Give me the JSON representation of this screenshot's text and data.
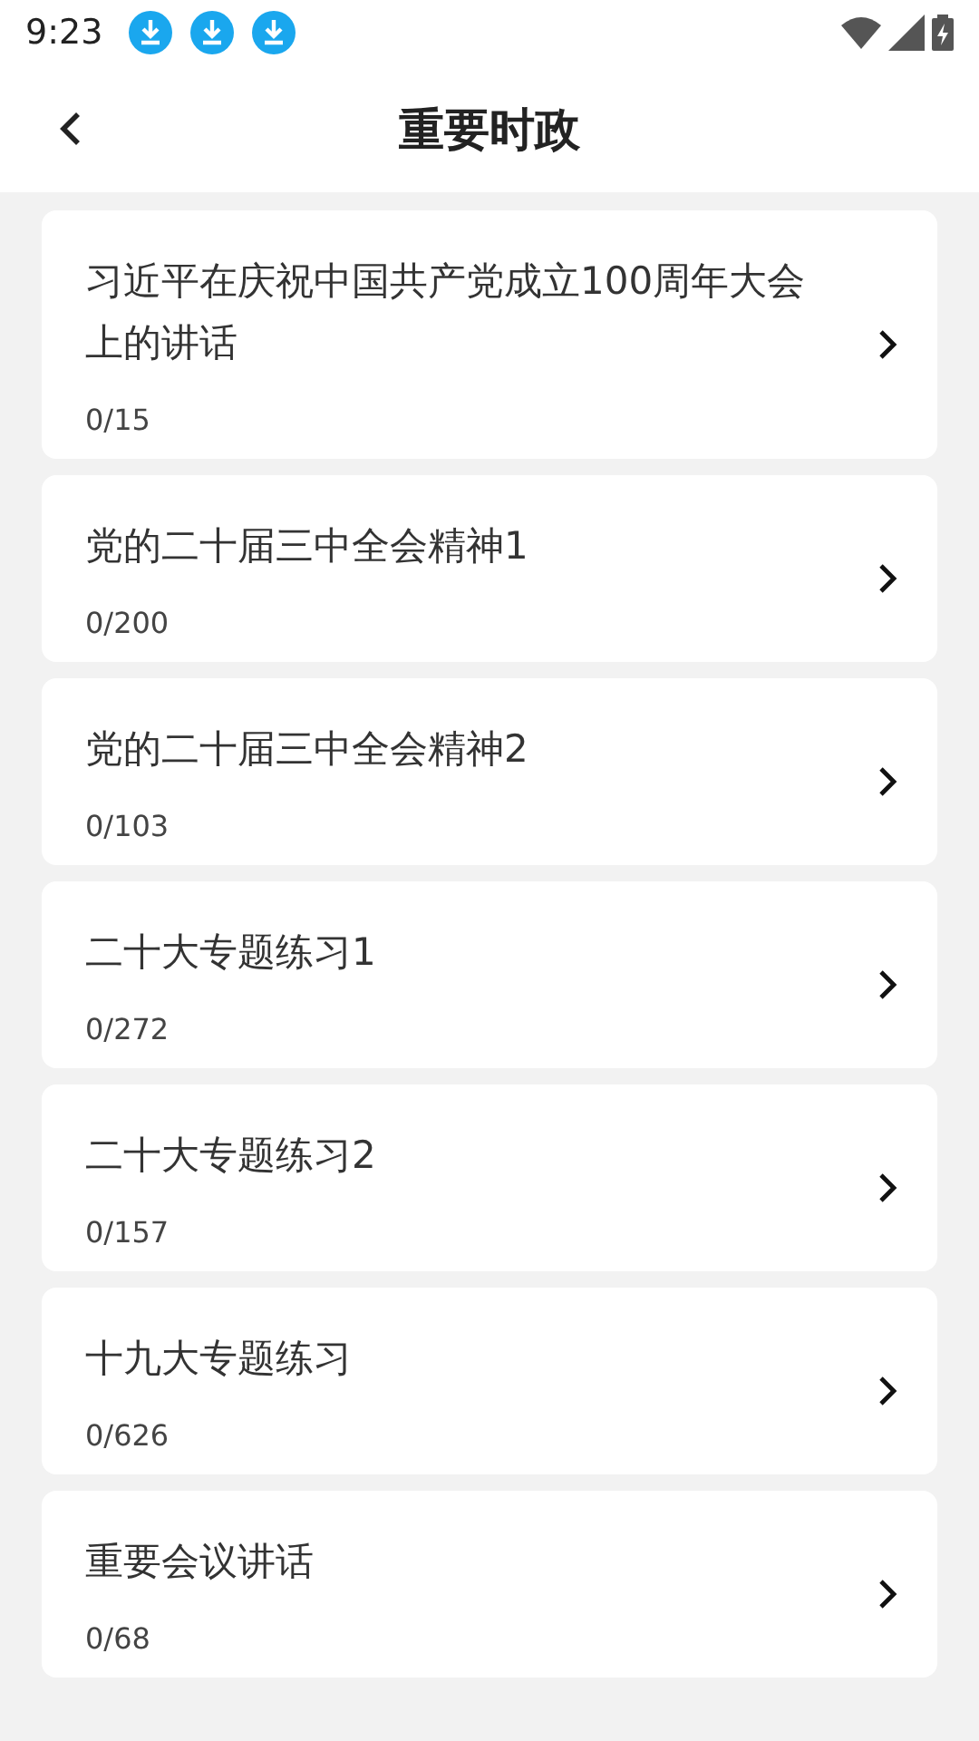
{
  "status_bar": {
    "time": "9:23",
    "notifications": [
      {
        "kind": "download"
      },
      {
        "kind": "download"
      },
      {
        "kind": "download"
      }
    ]
  },
  "header": {
    "title": "重要时政"
  },
  "items": [
    {
      "title": "习近平在庆祝中国共产党成立100周年大会上的讲话",
      "progress": "0/15"
    },
    {
      "title": "党的二十届三中全会精神1",
      "progress": "0/200"
    },
    {
      "title": "党的二十届三中全会精神2",
      "progress": "0/103"
    },
    {
      "title": "二十大专题练习1",
      "progress": "0/272"
    },
    {
      "title": "二十大专题练习2",
      "progress": "0/157"
    },
    {
      "title": "十九大专题练习",
      "progress": "0/626"
    },
    {
      "title": "重要会议讲话",
      "progress": "0/68"
    }
  ]
}
